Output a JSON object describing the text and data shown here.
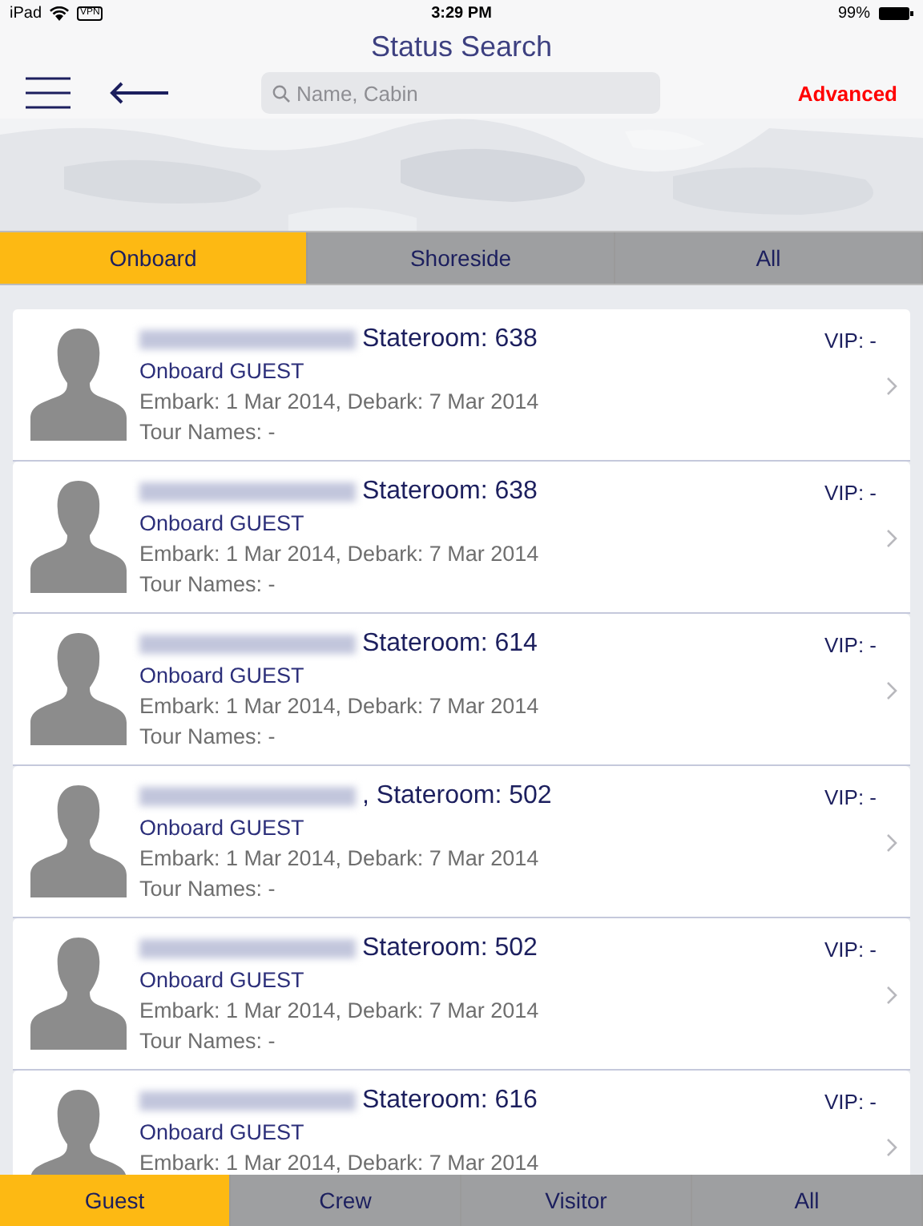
{
  "status_bar": {
    "device": "iPad",
    "vpn": "VPN",
    "time": "3:29 PM",
    "battery": "99%"
  },
  "title": "Status Search",
  "toolbar": {
    "search": {
      "placeholder": "Name, Cabin"
    },
    "advanced": "Advanced"
  },
  "tabs": [
    {
      "label": "Onboard",
      "selected": true
    },
    {
      "label": "Shoreside",
      "selected": false
    },
    {
      "label": "All",
      "selected": false
    }
  ],
  "rows": [
    {
      "name_blurred": true,
      "stateroom": "Stateroom: 638",
      "status": "Onboard GUEST",
      "dates": "Embark: 1 Mar 2014, Debark: 7 Mar 2014",
      "tour": "Tour Names: -",
      "vip": "VIP: -"
    },
    {
      "name_blurred": true,
      "stateroom": "Stateroom: 638",
      "status": "Onboard GUEST",
      "dates": "Embark: 1 Mar 2014, Debark: 7 Mar 2014",
      "tour": "Tour Names: -",
      "vip": "VIP: -"
    },
    {
      "name_blurred": true,
      "stateroom": "Stateroom: 614",
      "status": "Onboard GUEST",
      "dates": "Embark: 1 Mar 2014, Debark: 7 Mar 2014",
      "tour": "Tour Names: -",
      "vip": "VIP: -"
    },
    {
      "name_blurred": true,
      "stateroom": ", Stateroom: 502",
      "status": "Onboard GUEST",
      "dates": "Embark: 1 Mar 2014, Debark: 7 Mar 2014",
      "tour": "Tour Names: -",
      "vip": "VIP: -"
    },
    {
      "name_blurred": true,
      "stateroom": "Stateroom: 502",
      "status": "Onboard GUEST",
      "dates": "Embark: 1 Mar 2014, Debark: 7 Mar 2014",
      "tour": "Tour Names: -",
      "vip": "VIP: -"
    },
    {
      "name_blurred": true,
      "stateroom": "Stateroom: 616",
      "status": "Onboard GUEST",
      "dates": "Embark: 1 Mar 2014, Debark: 7 Mar 2014",
      "vip": "VIP: -"
    }
  ],
  "bottom_tabs": [
    {
      "label": "Guest",
      "selected": true
    },
    {
      "label": "Crew",
      "selected": false
    },
    {
      "label": "Visitor",
      "selected": false
    },
    {
      "label": "All",
      "selected": false
    }
  ]
}
